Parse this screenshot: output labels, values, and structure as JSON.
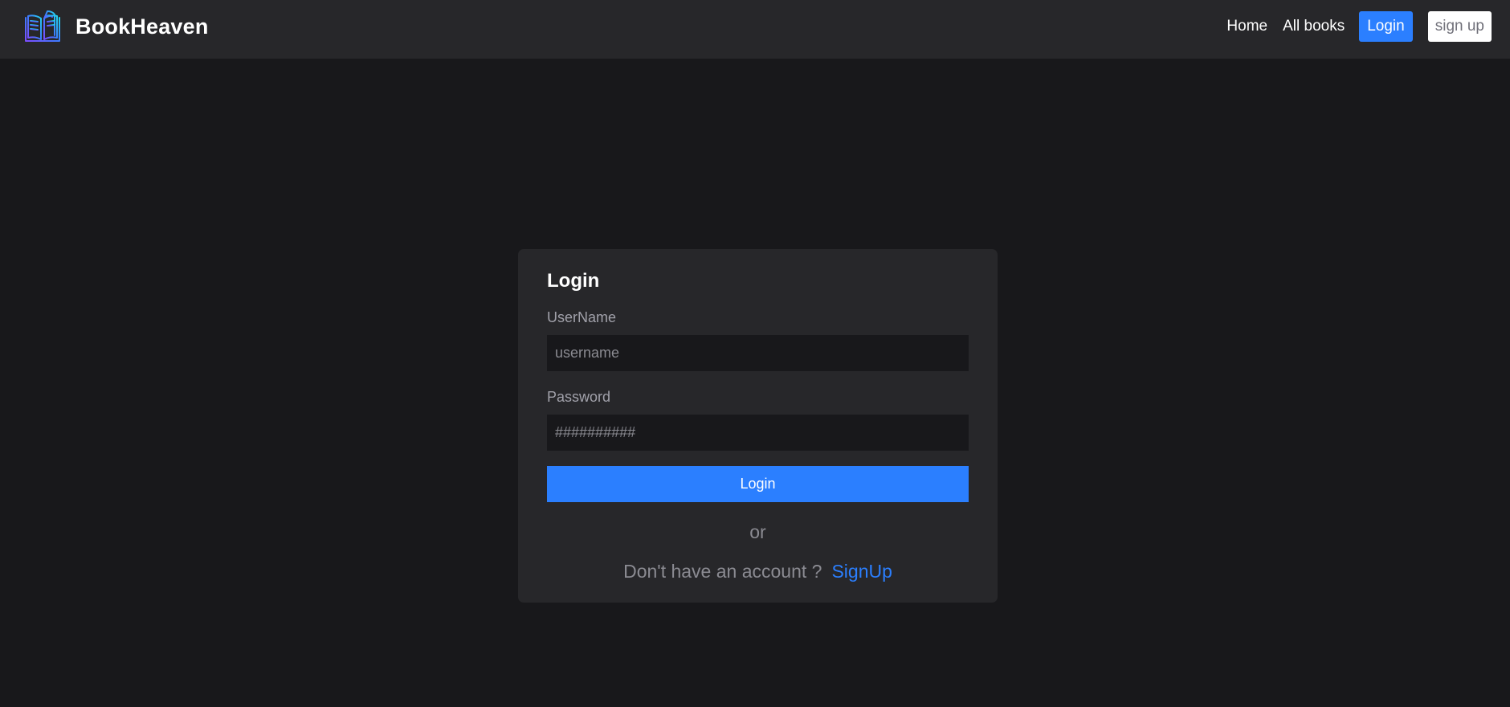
{
  "brand": {
    "name": "BookHeaven",
    "logo_icon": "open-book-icon"
  },
  "nav": {
    "links": [
      {
        "label": "Home"
      },
      {
        "label": "All books"
      }
    ],
    "login_label": "Login",
    "signup_label": "sign up"
  },
  "login_form": {
    "title": "Login",
    "username_label": "UserName",
    "username_placeholder": "username",
    "password_label": "Password",
    "password_placeholder": "##########",
    "submit_label": "Login",
    "or_text": "or",
    "signup_prompt": "Don't have an account ?",
    "signup_link": "SignUp"
  },
  "colors": {
    "page_bg": "#18181b",
    "navbar_bg": "#27272a",
    "card_bg": "#27272a",
    "accent": "#2b7fff",
    "muted_text": "#8b8b92"
  }
}
